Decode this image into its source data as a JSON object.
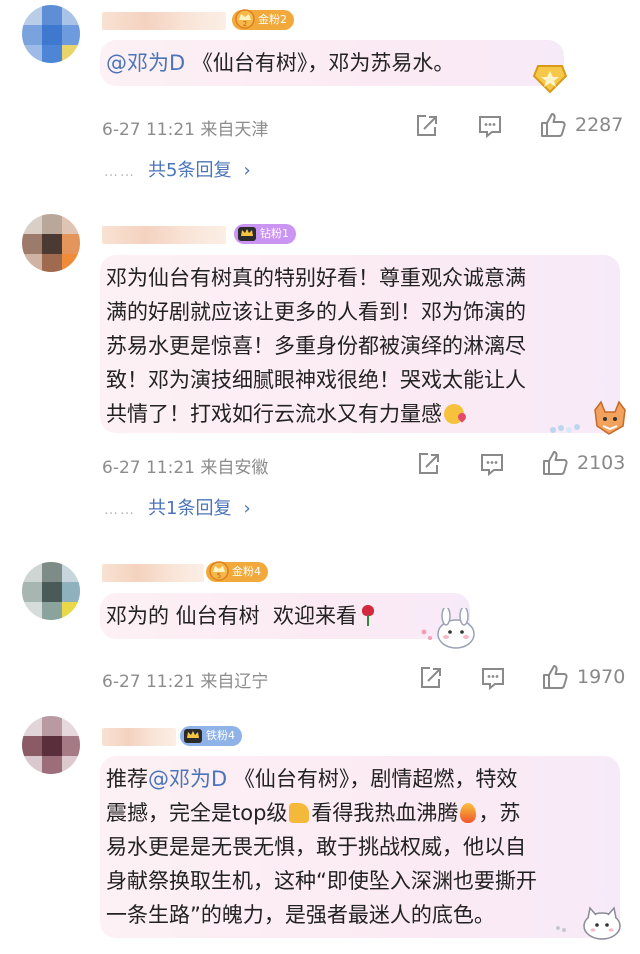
{
  "comments": [
    {
      "badge": "金粉2",
      "badge_color": "#f0a93a",
      "text_mention": "@邓为D",
      "text_rest": " 《仙台有树》，邓为苏易水。",
      "meta": "6-27 11:21 来自天津",
      "likes": "2287",
      "replies": "共5条回复"
    },
    {
      "badge": "钻粉1",
      "badge_color": "#c994f2",
      "text_lines": [
        "邓为仙台有树真的特别好看！尊重观众诚意满",
        "满的好剧就应该让更多的人看到！邓为饰演的",
        "苏易水更是惊喜！多重身份都被演绎的淋漓尽",
        "致！邓为演技细腻眼神戏很绝！哭戏太能让人",
        "共情了！打戏如行云流水又有力量感"
      ],
      "meta": "6-27 11:21 来自安徽",
      "likes": "2103",
      "replies": "共1条回复"
    },
    {
      "badge": "金粉4",
      "badge_color": "#f0a93a",
      "text": "邓为的 仙台有树  欢迎来看",
      "meta": "6-27 11:21 来自辽宁",
      "likes": "1970"
    },
    {
      "badge": "铁粉4",
      "badge_color": "#8fb3e6",
      "text_mention": "@邓为D",
      "text_line1_pre": "推荐",
      "text_line1_rest": " 《仙台有树》，剧情超燃，特效",
      "text_line2a": "震撼，完全是top级",
      "text_line2b": "看得我热血沸腾",
      "text_line2c": "，苏",
      "text_lines_more": [
        "易水更是是无畏无惧，敢于挑战权威，他以自",
        "身献祭换取生机，这种“即使坠入深渊也要撕开",
        "一条生路”的魄力，是强者最迷人的底色。"
      ]
    }
  ]
}
